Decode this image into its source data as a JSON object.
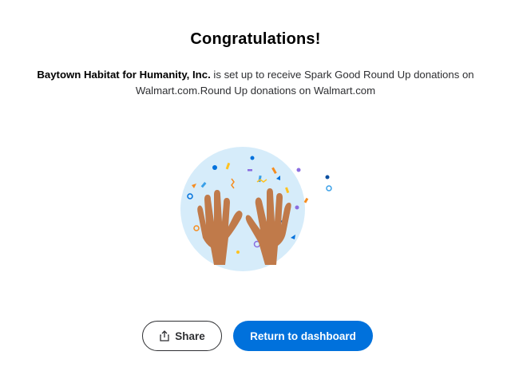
{
  "header": {
    "title": "Congratulations!"
  },
  "message": {
    "organization": "Baytown Habitat for Humanity, Inc.",
    "text": " is set up to receive Spark Good Round Up donations on Walmart.com.Round Up donations on Walmart.com"
  },
  "illustration": {
    "icon": "raised-hands-confetti-icon",
    "circle_color": "#d6ecfa",
    "hand_color": "#c07a4a"
  },
  "actions": {
    "share_label": "Share",
    "share_icon": "share-icon",
    "return_label": "Return to dashboard"
  },
  "colors": {
    "accent": "#0071dc",
    "text": "#2e2f32"
  }
}
